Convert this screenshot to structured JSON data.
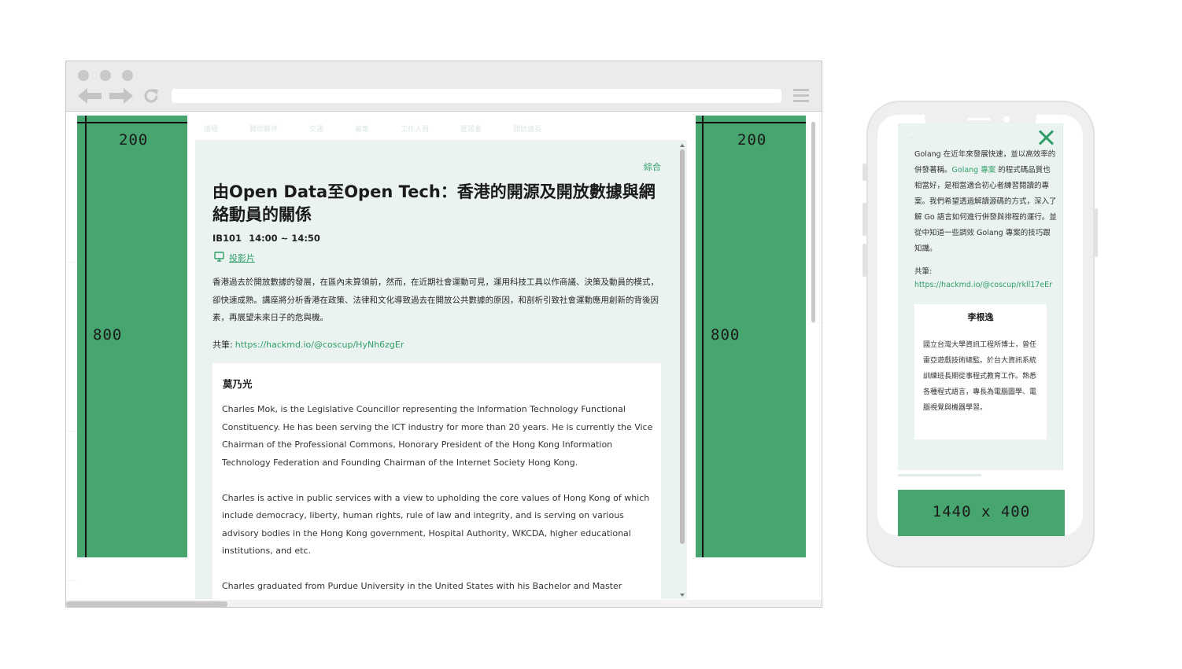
{
  "background_nav": [
    "議程",
    "贊助夥伴",
    "交通",
    "募集",
    "工作人員",
    "歷屆會",
    "開放議長"
  ],
  "ad_left": {
    "width_label": "200",
    "height_label": "800"
  },
  "ad_right": {
    "width_label": "200",
    "height_label": "800"
  },
  "modal": {
    "category": "綜合",
    "title": "由Open Data至Open Tech：香港的開源及開放數據與網絡動員的關係",
    "room": "IB101",
    "time": "14:00 ~ 14:50",
    "slides_label": "投影片",
    "abstract": "香港過去於開放數據的發展，在區內未算領前，然而，在近期社會運動可見，運用科技工具以作商議、決策及動員的模式，卻快速成熟。講座將分析香港在政策、法律和文化導致過去在開放公共數據的原因，和剖析引致社會運動應用創新的背後因素，再展望未來日子的危與機。",
    "hackmd_label": "共筆:",
    "hackmd_url": "https://hackmd.io/@coscup/HyNh6zgEr",
    "speaker": {
      "name": "莫乃光",
      "bio": [
        "Charles Mok, is the Legislative Councillor representing the Information Technology Functional Constituency. He has been serving the ICT industry for more than 20 years. He is currently the Vice Chairman of the Professional Commons, Honorary President of the Hong Kong Information Technology Federation and Founding Chairman of the Internet Society Hong Kong.",
        "Charles is active in public services with a view to upholding the core values of Hong Kong of which include democracy, liberty, human rights, rule of law and integrity, and is serving on various advisory bodies in the Hong Kong government, Hospital Authority, WKCDA, higher educational institutions, and etc.",
        "Charles graduated from Purdue University in the United States with his Bachelor and Master degrees of"
      ]
    }
  },
  "mobile": {
    "text_part1": "Golang 在近年來發展快速，並以高效率的併發著稱。",
    "text_highlight": "Golang 專案",
    "text_part2": " 的程式碼品質也相當好，是相當適合初心者練習閱讀的專案。我們希望透過解讀源碼的方式，深入了解 Go 語言如何進行併發與排程的運行。並從中知道一些調效 Golang 專案的技巧跟知識。",
    "hackmd_label": "共筆:",
    "hackmd_url": "https://hackmd.io/@coscup/rkll17eEr",
    "speaker_name": "李根逸",
    "speaker_bio": "國立台灣大學資訊工程所博士，曾任雷亞遊戲技術總監。於台大資訊系統訓練班長期從事程式教育工作。熟悉各種程式語言，專長為電腦圖學、電腦視覺與機器學習。",
    "ad_label": "1440 x 400"
  },
  "colors": {
    "brand_green": "#47a56f",
    "link_green": "#2f9e68",
    "modal_bg": "#eaf3f0"
  },
  "icons": [
    "back-arrow-icon",
    "forward-arrow-icon",
    "reload-icon",
    "hamburger-menu-icon",
    "slides-icon",
    "close-icon"
  ]
}
